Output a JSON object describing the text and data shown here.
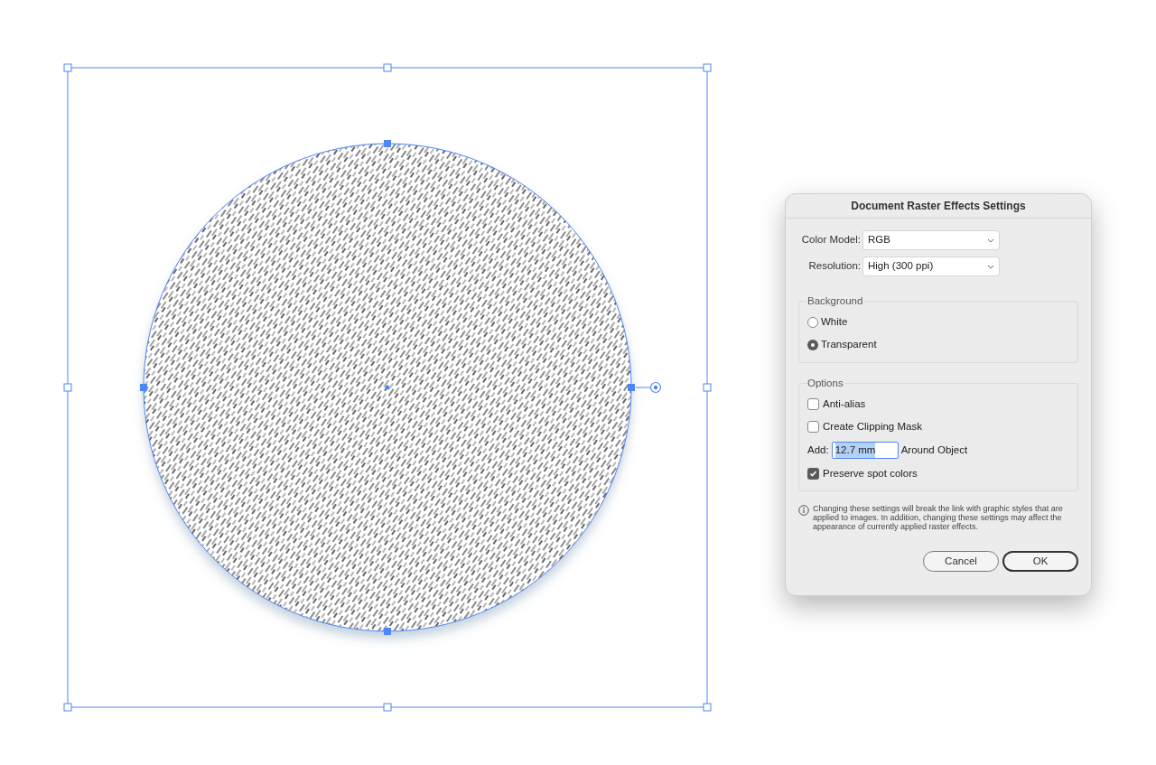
{
  "dialog": {
    "title": "Document Raster Effects Settings",
    "selects": [
      {
        "label": "Color Model:",
        "value": "RGB"
      },
      {
        "label": "Resolution:",
        "value": "High (300 ppi)"
      }
    ],
    "background": {
      "title": "Background",
      "options": [
        {
          "label": "White",
          "selected": false
        },
        {
          "label": "Transparent",
          "selected": true
        }
      ]
    },
    "options": {
      "title": "Options",
      "items": [
        {
          "kind": "checkbox",
          "label": "Anti-alias",
          "checked": false
        },
        {
          "kind": "checkbox",
          "label": "Create Clipping Mask",
          "checked": false
        },
        {
          "kind": "field",
          "label": "Add:",
          "value": "12.7 mm",
          "suffix": "Around Object"
        },
        {
          "kind": "checkbox",
          "label": "Preserve spot colors",
          "checked": true
        }
      ]
    },
    "note": "Changing these settings will break the link with graphic styles that are applied to images. In addition, changing these settings may affect the appearance of currently applied raster effects.",
    "buttons": [
      {
        "label": "Cancel",
        "default": false
      },
      {
        "label": "OK",
        "default": true
      }
    ]
  }
}
